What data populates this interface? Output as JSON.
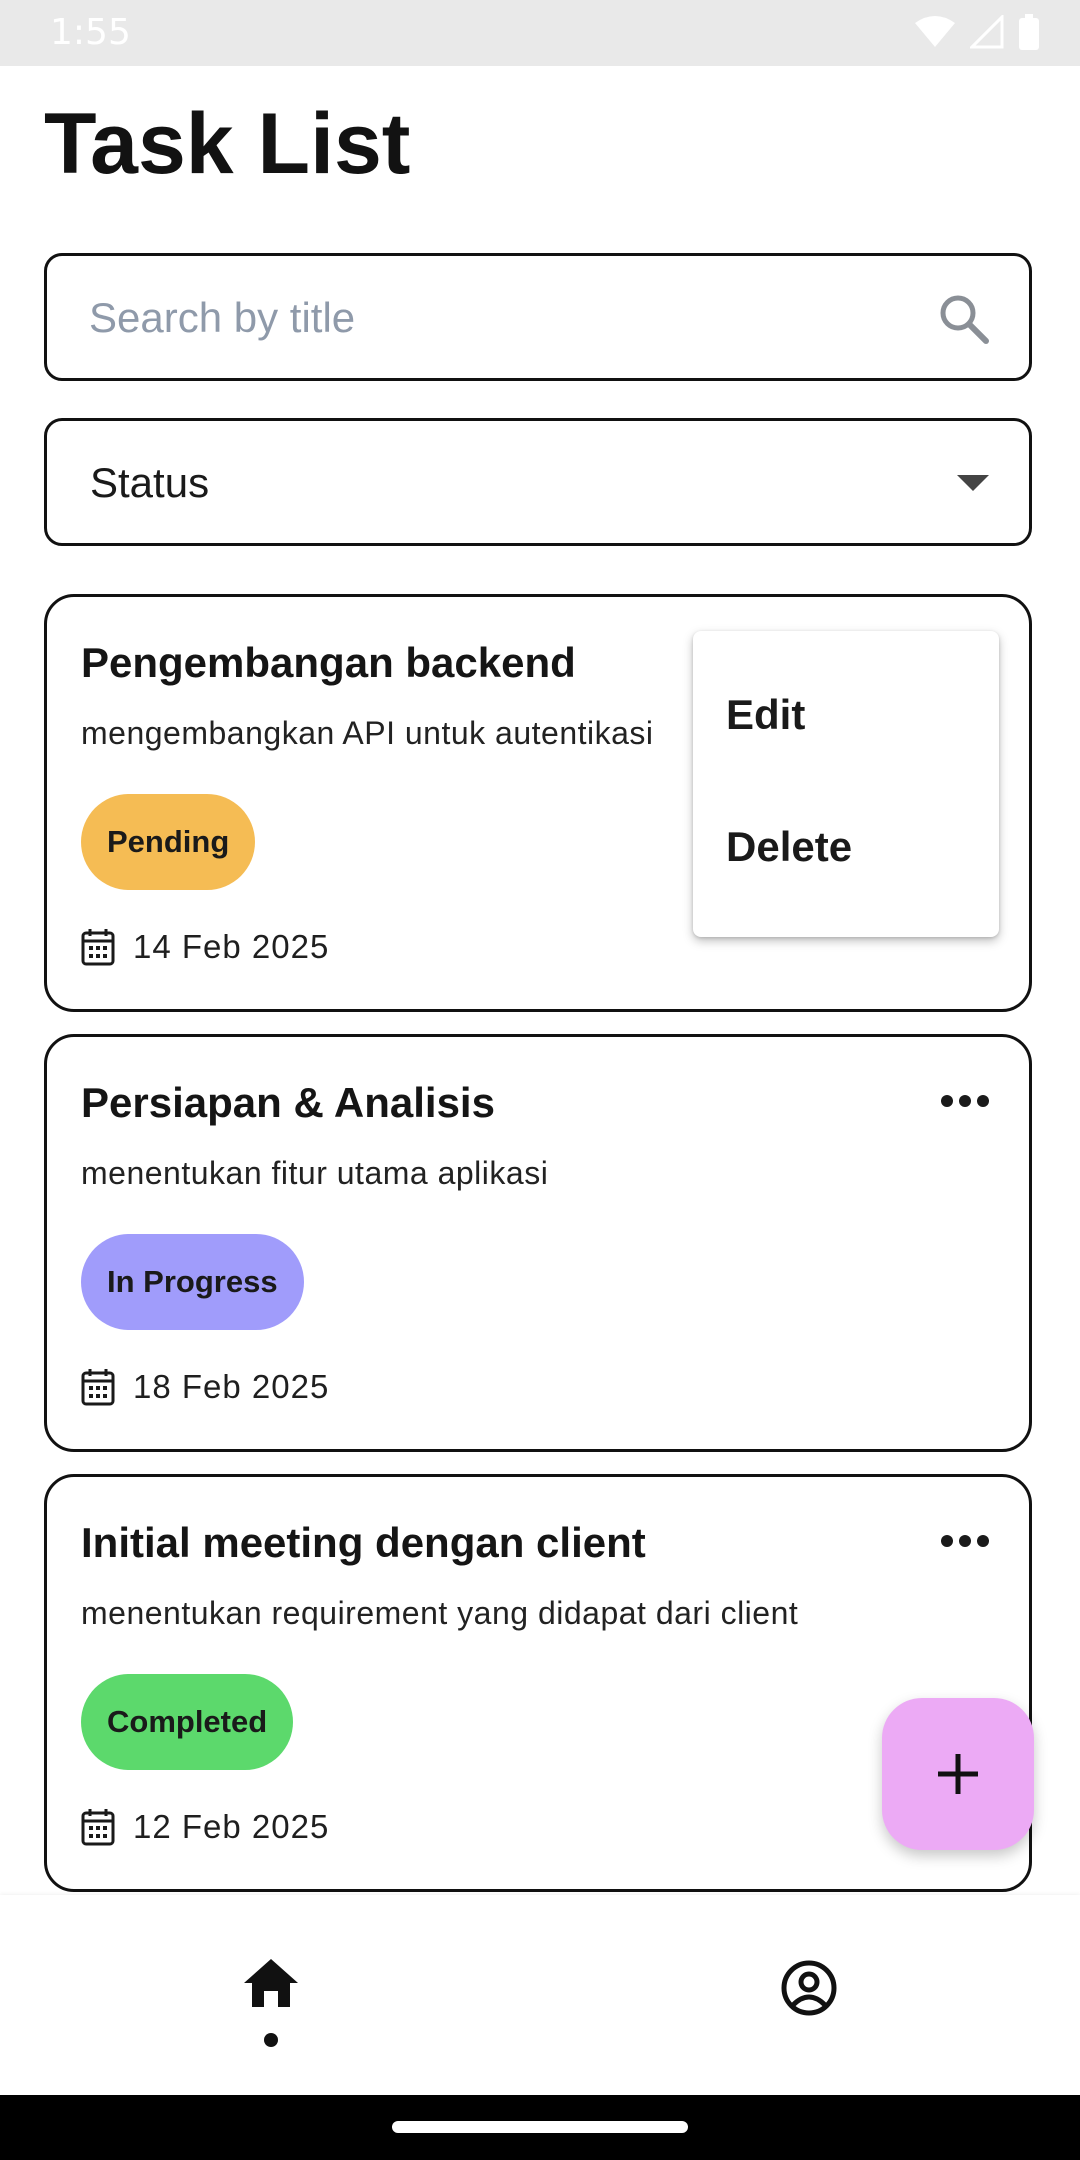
{
  "status_bar": {
    "time": "1:55"
  },
  "page": {
    "title": "Task List"
  },
  "search": {
    "placeholder": "Search by title"
  },
  "status_filter": {
    "label": "Status"
  },
  "tasks": [
    {
      "title": "Pengembangan backend",
      "description": "mengembangkan API untuk autentikasi",
      "status": "Pending",
      "status_color": "#f5bc54",
      "date": "14 Feb 2025"
    },
    {
      "title": "Persiapan & Analisis",
      "description": "menentukan fitur utama aplikasi",
      "status": "In Progress",
      "status_color": "#a09cfb",
      "date": "18 Feb 2025"
    },
    {
      "title": "Initial meeting dengan client",
      "description": "menentukan requirement yang didapat dari client",
      "status": "Completed",
      "status_color": "#5cd96c",
      "date": "12 Feb 2025"
    }
  ],
  "context_menu": {
    "edit": "Edit",
    "delete": "Delete"
  },
  "fab": {
    "icon": "plus-icon",
    "color": "#ecaaf5"
  },
  "bottom_nav": {
    "items": [
      {
        "icon": "home-icon",
        "active": true
      },
      {
        "icon": "account-circle-icon",
        "active": false
      }
    ]
  }
}
